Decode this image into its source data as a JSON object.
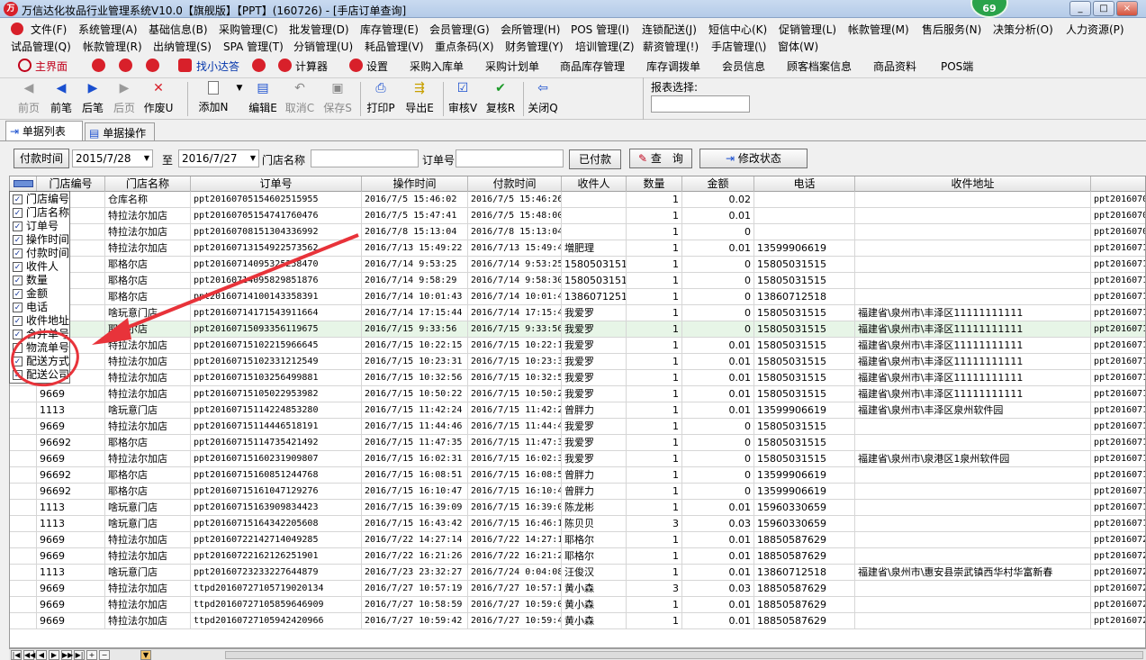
{
  "title": "万信达化妆品行业管理系统V10.0【旗舰版】【PPT】(160726) - [手店订单查询]",
  "notification_count": "69",
  "window_buttons": [
    "_",
    "□",
    "×"
  ],
  "menu_row1": [
    "文件(F)",
    "系统管理(A)",
    "基础信息(B)",
    "采购管理(C)",
    "批发管理(D)",
    "库存管理(E)",
    "会员管理(G)",
    "会所管理(H)",
    "POS 管理(I)",
    "连锁配送(J)",
    "短信中心(K)",
    "促销管理(L)",
    "帐款管理(M)",
    "售后服务(N)",
    "决策分析(O)",
    "人力资源(P)"
  ],
  "menu_row2": [
    "试品管理(Q)",
    "帐款管理(R)",
    "出纳管理(S)",
    "SPA 管理(T)",
    "分销管理(U)",
    "耗品管理(V)",
    "重点条码(X)",
    "财务管理(Y)",
    "培训管理(Z)",
    "薪资管理(!)",
    "手店管理(\\)",
    "窗体(W)"
  ],
  "quickbar": {
    "home": "主界面",
    "find": "找小达答",
    "calculator": "计算器",
    "settings": "设置",
    "links": [
      "采购入库单",
      "采购计划单",
      "商品库存管理",
      "库存调拨单",
      "会员信息",
      "顾客档案信息",
      "商品资料",
      "POS端"
    ]
  },
  "toolbar": [
    "前页",
    "前笔",
    "后笔",
    "后页",
    "作废U",
    "添加N",
    "编辑E",
    "取消C",
    "保存S",
    "打印P",
    "导出E",
    "审核V",
    "复核R",
    "关闭Q"
  ],
  "report_select_label": "报表选择:",
  "tabs": [
    "单据列表",
    "单据操作"
  ],
  "filter": {
    "pay_time_btn": "付款时间",
    "date_from": "2015/7/28",
    "to_label": "至",
    "date_to": "2016/7/27",
    "store_label": "门店名称",
    "order_label": "订单号",
    "paid_btn": "已付款",
    "query_btn": "查　询",
    "modify_btn": "修改状态"
  },
  "columns": [
    "门店编号",
    "门店名称",
    "订单号",
    "操作时间",
    "付款时间",
    "收件人",
    "数量",
    "金额",
    "电话",
    "收件地址",
    "合"
  ],
  "rows": [
    [
      "",
      "仓库名称",
      "ppt20160705154602515955",
      "2016/7/5 15:46:02",
      "2016/7/5 15:46:26",
      "",
      "1",
      "0.02",
      "",
      "",
      "ppt2016070"
    ],
    [
      "",
      "特拉法尔加店",
      "ppt20160705154741760476",
      "2016/7/5 15:47:41",
      "2016/7/5 15:48:00",
      "",
      "1",
      "0.01",
      "",
      "",
      "ppt2016070"
    ],
    [
      "",
      "特拉法尔加店",
      "ppt20160708151304336992",
      "2016/7/8 15:13:04",
      "2016/7/8 15:13:04",
      "",
      "1",
      "0",
      "",
      "",
      "ppt2016070"
    ],
    [
      "",
      "特拉法尔加店",
      "ppt20160713154922573562",
      "2016/7/13 15:49:22",
      "2016/7/13 15:49:49",
      "増肥理",
      "1",
      "0.01",
      "13599906619",
      "",
      "ppt2016071"
    ],
    [
      "",
      "耶格尔店",
      "ppt20160714095325258470",
      "2016/7/14 9:53:25",
      "2016/7/14 9:53:25",
      "15805031515",
      "1",
      "0",
      "15805031515",
      "",
      "ppt2016071"
    ],
    [
      "",
      "耶格尔店",
      "ppt20160714095829851876",
      "2016/7/14 9:58:29",
      "2016/7/14 9:58:30",
      "15805031515",
      "1",
      "0",
      "15805031515",
      "",
      "ppt2016071"
    ],
    [
      "",
      "耶格尔店",
      "ppt20160714100143358391",
      "2016/7/14 10:01:43",
      "2016/7/14 10:01:43",
      "13860712518",
      "1",
      "0",
      "13860712518",
      "",
      "ppt2016071"
    ],
    [
      "",
      "啥玩意门店",
      "ppt20160714171543911664",
      "2016/7/14 17:15:44",
      "2016/7/14 17:15:44",
      "我爱罗",
      "1",
      "0",
      "15805031515",
      "福建省\\泉州市\\丰泽区11111111111",
      "ppt2016071"
    ],
    [
      "",
      "耶格尔店",
      "ppt20160715093356119675",
      "2016/7/15 9:33:56",
      "2016/7/15 9:33:56",
      "我爱罗",
      "1",
      "0",
      "15805031515",
      "福建省\\泉州市\\丰泽区11111111111",
      "ppt2016071"
    ],
    [
      "",
      "特拉法尔加店",
      "ppt20160715102215966645",
      "2016/7/15 10:22:15",
      "2016/7/15 10:22:15",
      "我爱罗",
      "1",
      "0.01",
      "15805031515",
      "福建省\\泉州市\\丰泽区11111111111",
      "ppt2016071"
    ],
    [
      "",
      "特拉法尔加店",
      "ppt20160715102331212549",
      "2016/7/15 10:23:31",
      "2016/7/15 10:23:31",
      "我爱罗",
      "1",
      "0.01",
      "15805031515",
      "福建省\\泉州市\\丰泽区11111111111",
      "ppt2016071"
    ],
    [
      "",
      "特拉法尔加店",
      "ppt20160715103256499881",
      "2016/7/15 10:32:56",
      "2016/7/15 10:32:56",
      "我爱罗",
      "1",
      "0.01",
      "15805031515",
      "福建省\\泉州市\\丰泽区11111111111",
      "ppt2016071"
    ],
    [
      "9669",
      "特拉法尔加店",
      "ppt20160715105022953982",
      "2016/7/15 10:50:22",
      "2016/7/15 10:50:22",
      "我爱罗",
      "1",
      "0.01",
      "15805031515",
      "福建省\\泉州市\\丰泽区11111111111",
      "ppt2016071"
    ],
    [
      "1113",
      "啥玩意门店",
      "ppt20160715114224853280",
      "2016/7/15 11:42:24",
      "2016/7/15 11:42:24",
      "曾胖力",
      "1",
      "0.01",
      "13599906619",
      "福建省\\泉州市\\丰泽区泉州软件园",
      "ppt2016071"
    ],
    [
      "9669",
      "特拉法尔加店",
      "ppt20160715114446518191",
      "2016/7/15 11:44:46",
      "2016/7/15 11:44:46",
      "我爱罗",
      "1",
      "0",
      "15805031515",
      "",
      "ppt2016071"
    ],
    [
      "96692",
      "耶格尔店",
      "ppt20160715114735421492",
      "2016/7/15 11:47:35",
      "2016/7/15 11:47:35",
      "我爱罗",
      "1",
      "0",
      "15805031515",
      "",
      "ppt2016071"
    ],
    [
      "9669",
      "特拉法尔加店",
      "ppt20160715160231909807",
      "2016/7/15 16:02:31",
      "2016/7/15 16:02:31",
      "我爱罗",
      "1",
      "0",
      "15805031515",
      "福建省\\泉州市\\泉港区1泉州软件园",
      "ppt2016071"
    ],
    [
      "96692",
      "耶格尔店",
      "ppt20160715160851244768",
      "2016/7/15 16:08:51",
      "2016/7/15 16:08:51",
      "曾胖力",
      "1",
      "0",
      "13599906619",
      "",
      "ppt2016071"
    ],
    [
      "96692",
      "耶格尔店",
      "ppt20160715161047129276",
      "2016/7/15 16:10:47",
      "2016/7/15 16:10:47",
      "曾胖力",
      "1",
      "0",
      "13599906619",
      "",
      "ppt2016071"
    ],
    [
      "1113",
      "啥玩意门店",
      "ppt20160715163909834423",
      "2016/7/15 16:39:09",
      "2016/7/15 16:39:09",
      "陈龙彬",
      "1",
      "0.01",
      "15960330659",
      "",
      "ppt2016071"
    ],
    [
      "1113",
      "啥玩意门店",
      "ppt20160715164342205608",
      "2016/7/15 16:43:42",
      "2016/7/15 16:46:15",
      "陈贝贝",
      "3",
      "0.03",
      "15960330659",
      "",
      "ppt2016071"
    ],
    [
      "9669",
      "特拉法尔加店",
      "ppt20160722142714049285",
      "2016/7/22 14:27:14",
      "2016/7/22 14:27:14",
      "耶格尔",
      "1",
      "0.01",
      "18850587629",
      "",
      "ppt2016072"
    ],
    [
      "9669",
      "特拉法尔加店",
      "ppt20160722162126251901",
      "2016/7/22 16:21:26",
      "2016/7/22 16:21:26",
      "耶格尔",
      "1",
      "0.01",
      "18850587629",
      "",
      "ppt2016072"
    ],
    [
      "1113",
      "啥玩意门店",
      "ppt20160723233227644879",
      "2016/7/23 23:32:27",
      "2016/7/24 0:04:08",
      "汪俊汉",
      "1",
      "0.01",
      "13860712518",
      "福建省\\泉州市\\惠安县崇武镇西华村华富新春",
      "ppt2016072"
    ],
    [
      "9669",
      "特拉法尔加店",
      "ttpd20160727105719020134",
      "2016/7/27 10:57:19",
      "2016/7/27 10:57:19",
      "黄小森",
      "3",
      "0.03",
      "18850587629",
      "",
      "ppt2016072"
    ],
    [
      "9669",
      "特拉法尔加店",
      "ttpd20160727105859646909",
      "2016/7/27 10:58:59",
      "2016/7/27 10:59:00",
      "黄小森",
      "1",
      "0.01",
      "18850587629",
      "",
      "ppt2016072"
    ],
    [
      "9669",
      "特拉法尔加店",
      "ttpd20160727105942420966",
      "2016/7/27 10:59:42",
      "2016/7/27 10:59:42",
      "黄小森",
      "1",
      "0.01",
      "18850587629",
      "",
      "ppt2016072"
    ]
  ],
  "column_popup": {
    "items": [
      {
        "label": "门店编号",
        "checked": "✓"
      },
      {
        "label": "门店名称",
        "checked": "✓"
      },
      {
        "label": "订单号",
        "checked": "✓"
      },
      {
        "label": "操作时间",
        "checked": "✓"
      },
      {
        "label": "付款时间",
        "checked": "✓"
      },
      {
        "label": "收件人",
        "checked": "✓"
      },
      {
        "label": "数量",
        "checked": "✓"
      },
      {
        "label": "金额",
        "checked": "✓"
      },
      {
        "label": "电话",
        "checked": "✓"
      },
      {
        "label": "收件地址",
        "checked": "✓"
      },
      {
        "label": "合并单号",
        "checked": "✓"
      },
      {
        "label": "物流单号",
        "checked": ""
      },
      {
        "label": "配送方式",
        "checked": "✓"
      },
      {
        "label": "配送公司",
        "checked": "✓"
      }
    ]
  },
  "nav_buttons": [
    "|◀",
    "◀◀",
    "◀",
    "▶",
    "▶▶",
    "▶|",
    "+",
    "−"
  ]
}
